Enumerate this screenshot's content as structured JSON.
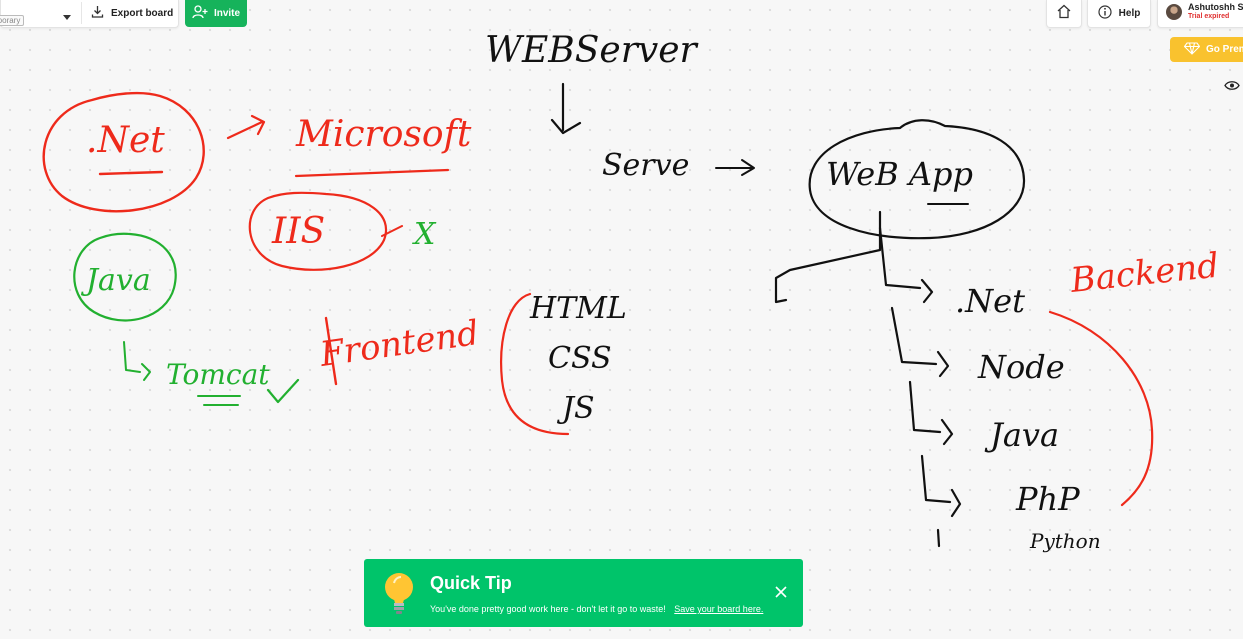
{
  "toolbar": {
    "temporary_tag": "mporary",
    "export_label": "Export board",
    "invite_label": "Invite",
    "help_label": "Help",
    "user_name": "Ashutoshh Si",
    "user_status": "Trial expired",
    "premium_label": "Go Prem"
  },
  "board": {
    "webserver": "WEBServer",
    "serve": "Serve",
    "web_app": "WeB App",
    "dotnet_left": ".Net",
    "microsoft": "Microsoft",
    "iis": "IIS",
    "cross": "X",
    "java_left": "Java",
    "tomcat": "Tomcat",
    "frontend": "Frontend",
    "html": "HTML",
    "css": "CSS",
    "js": "JS",
    "backend": "Backend",
    "net_right": ".Net",
    "node": "Node",
    "java_right": "Java",
    "php": "PhP",
    "python": "Python"
  },
  "tip": {
    "title": "Quick Tip",
    "message": "You've done pretty good work here - don't let it go to waste!",
    "link": "Save your board here."
  },
  "colors": {
    "ink_black": "#111111",
    "ink_red": "#ee2a1b",
    "ink_green": "#22b030",
    "tip_bg": "#00c46a",
    "invite_bg": "#16b35b",
    "premium_bg": "#f9c22e"
  }
}
